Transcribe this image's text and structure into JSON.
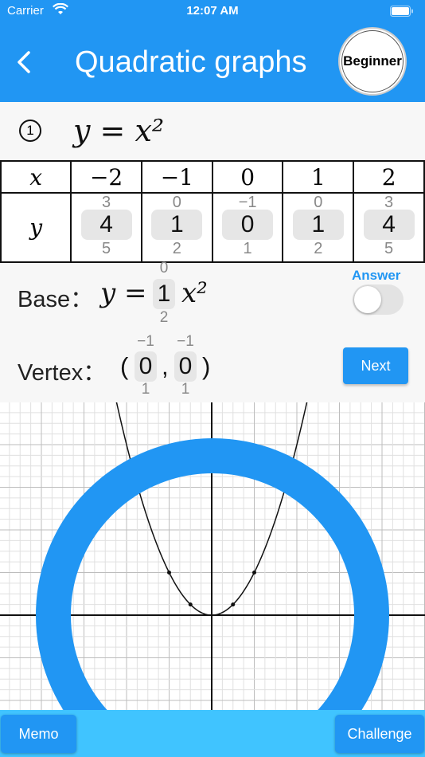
{
  "status_bar": {
    "carrier": "Carrier",
    "time": "12:07 AM"
  },
  "header": {
    "title": "Quadratic graphs",
    "level": "Beginner",
    "back_icon": "chevron-left-icon"
  },
  "problem": {
    "number": "1",
    "equation": "y = x²"
  },
  "table": {
    "x_label": "x",
    "y_label": "y",
    "x_values": [
      "−2",
      "−1",
      "0",
      "1",
      "2"
    ],
    "y_pickers": [
      {
        "above": "3",
        "current": "4",
        "below": "5"
      },
      {
        "above": "0",
        "current": "1",
        "below": "2"
      },
      {
        "above": "−1",
        "current": "0",
        "below": "1"
      },
      {
        "above": "0",
        "current": "1",
        "below": "2"
      },
      {
        "above": "3",
        "current": "4",
        "below": "5"
      }
    ]
  },
  "base": {
    "label": "Base：",
    "lhs": "y =",
    "coef": {
      "above": "0",
      "current": "1",
      "below": "2"
    },
    "rhs": "x²"
  },
  "answer_toggle": {
    "label": "Answer",
    "on": false
  },
  "vertex": {
    "label": "Vertex：",
    "open": "(",
    "comma": ",",
    "close": ")",
    "h": {
      "above": "−1",
      "current": "0",
      "below": "1"
    },
    "k": {
      "above": "−1",
      "current": "0",
      "below": "1"
    }
  },
  "next_button": "Next",
  "graph": {
    "function": "y = x^2",
    "grid_minor_color": "#e0e0e0",
    "grid_major_color": "#bdbdbd",
    "curve_color": "#111111",
    "overlay_ring_color": "#2196f3",
    "marked_points": [
      [
        -2,
        4
      ],
      [
        -1,
        1
      ],
      [
        0,
        0
      ],
      [
        1,
        1
      ],
      [
        2,
        4
      ]
    ]
  },
  "bottom_bar": {
    "memo": "Memo",
    "challenge": "Challenge"
  },
  "colors": {
    "primary": "#2196f3",
    "bottom_bar": "#40c4ff",
    "answer": "#2196f3"
  }
}
